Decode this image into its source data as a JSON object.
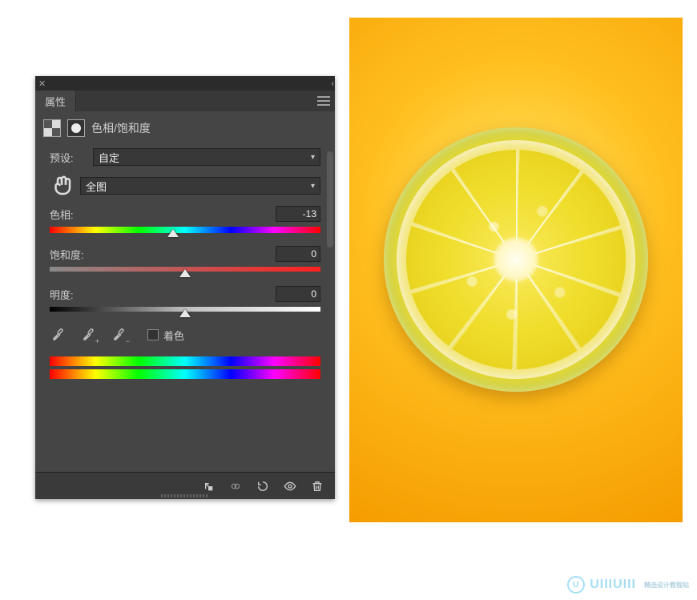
{
  "panel": {
    "tab_label": "属性",
    "adjustment_title": "色相/饱和度",
    "preset_label": "预设:",
    "preset_value": "自定",
    "channel_value": "全图",
    "sliders": {
      "hue": {
        "label": "色相:",
        "value": "-13",
        "pos_pct": 45.5
      },
      "saturation": {
        "label": "饱和度:",
        "value": "0",
        "pos_pct": 50.0
      },
      "lightness": {
        "label": "明度:",
        "value": "0",
        "pos_pct": 50.0
      }
    },
    "colorize_label": "着色"
  },
  "watermark": {
    "text": "UIIIUIII",
    "sub": "精选设计教程站"
  }
}
